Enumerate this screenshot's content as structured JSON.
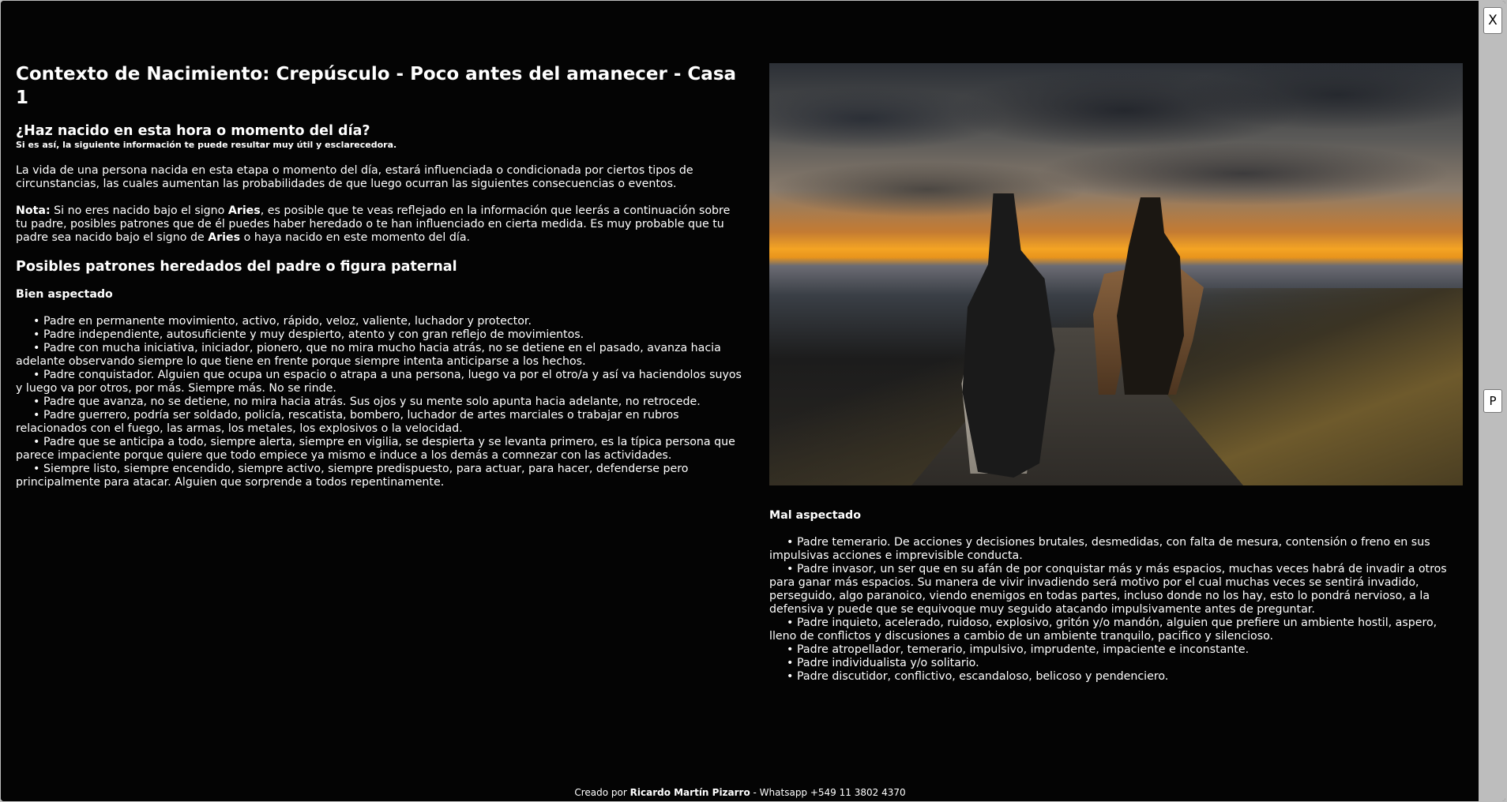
{
  "page": {
    "title": "Contexto de Nacimiento: Crepúsculo - Poco antes del amanecer - Casa 1",
    "question": "¿Haz nacido en esta hora o momento del día?",
    "subtitle": "Si es así, la siguiente información te puede resultar muy útil y esclarecedora.",
    "intro": "La vida de una persona nacida en esta etapa o momento del día, estará influenciada o condicionada por ciertos tipos de circunstancias, las cuales aumentan las probabilidades de que luego ocurran las siguientes consecuencias o eventos.",
    "note": {
      "label": "Nota:",
      "text1": " Si no eres nacido bajo el signo ",
      "sign1": "Aries",
      "text2": ", es posible que te veas reflejado en la información que leerás a continuación sobre tu padre, posibles patrones que de él puedes haber heredado o te han influenciado en cierta medida. Es muy probable que tu padre sea nacido bajo el signo de ",
      "sign2": "Aries",
      "text3": " o haya nacido en este momento del día."
    },
    "section_title": "Posibles patrones heredados del padre o figura paternal"
  },
  "good_aspect": {
    "title": "Bien aspectado",
    "items": [
      "Padre en permanente movimiento, activo, rápido, veloz, valiente, luchador y protector.",
      "Padre independiente, autosuficiente y muy despierto, atento y con gran reflejo de movimientos.",
      "Padre con mucha iniciativa, iniciador, pionero, que no mira mucho hacia atrás, no se detiene en el pasado, avanza hacia adelante observando siempre lo que tiene en frente porque siempre intenta anticiparse a los hechos.",
      "Padre conquistador. Alguien que ocupa un espacio o atrapa a una persona, luego va por el otro/a y así va haciendolos suyos y luego va por otros, por más. Siempre más. No se rinde.",
      "Padre que avanza, no se detiene, no mira hacia atrás. Sus ojos y su mente solo apunta hacia adelante, no retrocede.",
      "Padre guerrero, podría ser soldado, policía, rescatista, bombero, luchador de artes marciales o trabajar en rubros relacionados con el fuego, las armas, los metales, los explosivos o la velocidad.",
      "Padre que se anticipa a todo, siempre alerta, siempre en vigilia, se despierta y se levanta primero, es la típica persona que parece impaciente porque quiere que todo empiece ya mismo e induce a los demás a comnezar con las actividades.",
      "Siempre listo, siempre encendido, siempre activo, siempre predispuesto, para actuar, para hacer, defenderse pero principalmente para atacar. Alguien que sorprende a todos repentinamente."
    ]
  },
  "bad_aspect": {
    "title": "Mal aspectado",
    "items": [
      "Padre temerario. De acciones y decisiones brutales, desmedidas, con falta de mesura, contensión o freno en sus impulsivas acciones e imprevisible conducta.",
      "Padre invasor, un ser que en su afán de por conquistar más y más espacios, muchas veces habrá de invadir a otros para ganar más espacios. Su manera de vivir invadiendo será motivo por el cual muchas veces se sentirá invadido, perseguido, algo paranoico, viendo enemigos en todas partes, incluso donde no los hay, esto lo pondrá nervioso, a la defensiva y puede que se equivoque muy seguido atacando impulsivamente antes de preguntar.",
      "Padre inquieto, acelerado, ruidoso, explosivo, gritón y/o mandón, alguien que prefiere un ambiente hostil, aspero, lleno de conflictos y discusiones a cambio de un ambiente tranquilo, pacifico y silencioso.",
      "Padre atropellador, temerario, impulsivo, imprudente, impaciente e inconstante.",
      "Padre individualista y/o solitario.",
      "Padre discutidor, conflictivo, escandaloso, belicoso y pendenciero."
    ]
  },
  "controls": {
    "close_label": "X",
    "p_label": "P"
  },
  "footer": {
    "prefix": "Creado por ",
    "author": "Ricardo Martín Pizarro",
    "suffix": " - Whatsapp +549 11 3802 4370"
  }
}
